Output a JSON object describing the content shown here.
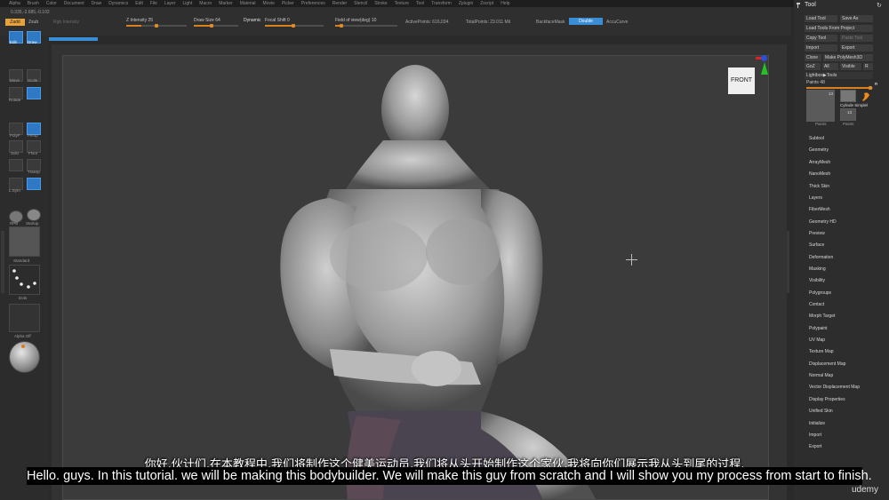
{
  "menu": [
    "Alpha",
    "Brush",
    "Color",
    "Document",
    "Draw",
    "Dynamics",
    "Edit",
    "File",
    "Layer",
    "Light",
    "Macro",
    "Marker",
    "Material",
    "Movie",
    "Picker",
    "Preferences",
    "Render",
    "Stencil",
    "Stroke",
    "Texture",
    "Tool",
    "Transform",
    "Zplugin",
    "Zscript",
    "Help"
  ],
  "toolbar": {
    "coords": "0.335,-2.685,-0.102",
    "zadd": "Zadd",
    "zsub": "Zsub",
    "rgb_intensity": "Rgb Intensity",
    "z_intensity_label": "Z Intensity",
    "z_intensity_value": "25",
    "draw_size_label": "Draw Size",
    "draw_size_value": "64",
    "dynamic": "Dynamic",
    "focal_shift_label": "Focal Shift",
    "focal_shift_value": "0",
    "fov_label": "Field of view(deg)",
    "fov_value": "10",
    "active_points": "ActivePoints: 616,034",
    "total_points": "TotalPoints: 23.011 Mil",
    "backface": "BackfaceMask",
    "double": "Double",
    "accucurve": "AccuCurve"
  },
  "leftshelf": {
    "edit": "Edit",
    "draw": "Draw",
    "move": "Move",
    "scale": "Scale",
    "rotate": "Rotate",
    "polyf": "PolyF",
    "persp": "Persp",
    "solo": "Solo",
    "floor": "Floor",
    "transp": "Transp",
    "lsym": "L.Sym",
    "rdb": "RPB",
    "startup": "Startup",
    "standard": "Standard",
    "dots": "Dots",
    "alpha_off": "Alpha Off"
  },
  "viewport": {
    "front_label": "FRONT"
  },
  "toolpanel": {
    "title": "Tool",
    "buttons": [
      "Load Tool",
      "Save As",
      "Load Tools From Project",
      "Copy Tool",
      "Paste Tool",
      "Import",
      "Export",
      "Clone",
      "Make PolyMesh3D",
      "GoZ",
      "All",
      "Visible",
      "R"
    ],
    "lightbox": "Lightbox▶Tools",
    "paints_label": "Paints",
    "paints_value": "48",
    "thumb_count_1": "13",
    "thumb_count_2": "13",
    "thumb_name_1": "Paints",
    "thumb_name_2": "Cylinde Simplel",
    "thumb_name_3": "Paints",
    "sections": [
      "Subtool",
      "Geometry",
      "ArrayMesh",
      "NanoMesh",
      "Thick Skin",
      "Layers",
      "FiberMesh",
      "Geometry HD",
      "Preview",
      "Surface",
      "Deformation",
      "Masking",
      "Visibility",
      "Polygroups",
      "Contact",
      "Morph Target",
      "Polypaint",
      "UV Map",
      "Texture Map",
      "Displacement Map",
      "Normal Map",
      "Vector Displacement Map",
      "Display Properties",
      "Unified Skin",
      "Initialize",
      "Import",
      "Export"
    ]
  },
  "subtitles": {
    "chinese": "你好,伙计们,在本教程中,我们将制作这个健美运动员,我们将从头开始制作这个家伙,我将向你们展示我从头到尾的过程,",
    "english": "Hello. guys. In this tutorial. we will be making this bodybuilder. We will make this guy from scratch and I will show you my process from start to finish."
  },
  "watermark": "udemy"
}
